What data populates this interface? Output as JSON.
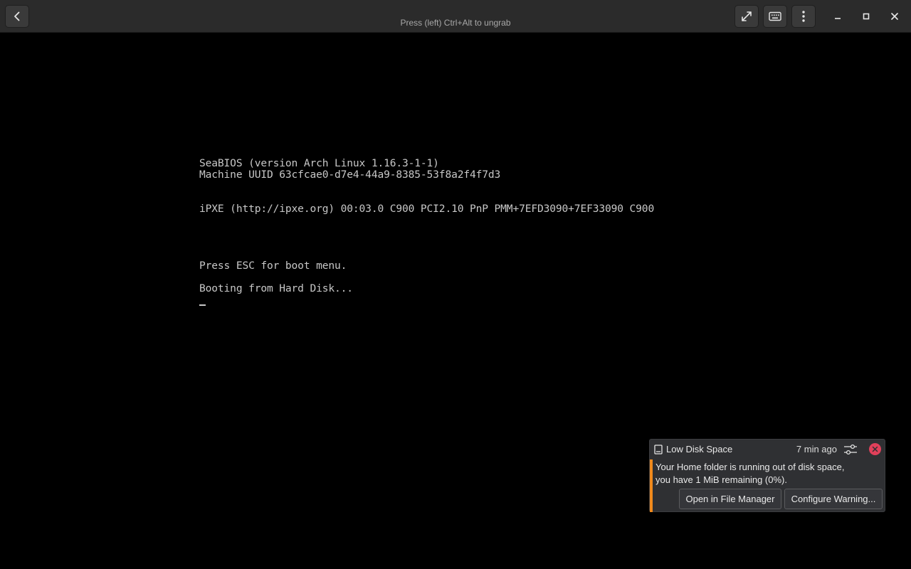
{
  "headerbar": {
    "title": "Press (left) Ctrl+Alt to ungrab",
    "back_icon": "chevron-left-icon",
    "fullscreen_icon": "expand-icon",
    "keyboard_icon": "keyboard-icon",
    "menu_icon": "kebab-menu-icon",
    "minimize_icon": "minimize-icon",
    "maximize_icon": "maximize-icon",
    "close_icon": "close-icon"
  },
  "console": {
    "lines": [
      "SeaBIOS (version Arch Linux 1.16.3-1-1)",
      "Machine UUID 63cfcae0-d7e4-44a9-8385-53f8a2f4f7d3",
      "iPXE (http://ipxe.org) 00:03.0 C900 PCI2.10 PnP PMM+7EFD3090+7EF33090 C900",
      "Press ESC for boot menu.",
      "Booting from Hard Disk..."
    ]
  },
  "notification": {
    "title": "Low Disk Space",
    "time": "7 min ago",
    "body_line1": "Your Home folder is running out of disk space,",
    "body_line2": "you have 1 MiB remaining (0%).",
    "action_open": "Open in File Manager",
    "action_configure": "Configure Warning...",
    "accent_color": "#f08a1c",
    "close_color": "#e0405a"
  }
}
